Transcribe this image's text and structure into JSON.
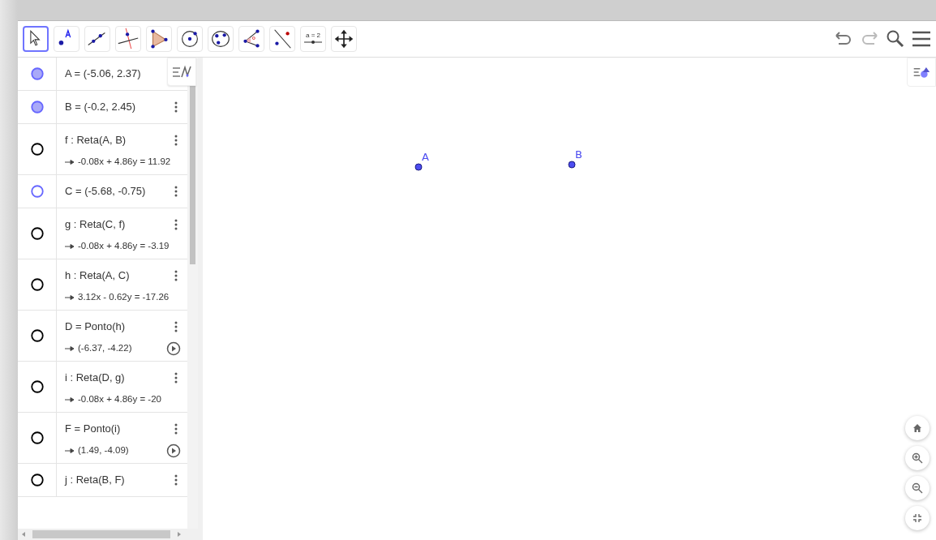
{
  "toolbar": {
    "tools": [
      {
        "kind": "move",
        "selected": true
      },
      {
        "kind": "point",
        "selected": false
      },
      {
        "kind": "line",
        "selected": false
      },
      {
        "kind": "perpendicular",
        "selected": false
      },
      {
        "kind": "polygon",
        "selected": false
      },
      {
        "kind": "circle",
        "selected": false
      },
      {
        "kind": "conic",
        "selected": false
      },
      {
        "kind": "angle",
        "selected": false
      },
      {
        "kind": "reflect",
        "selected": false
      },
      {
        "kind": "slider",
        "selected": false,
        "label": "a = 2"
      },
      {
        "kind": "pan",
        "selected": false
      }
    ]
  },
  "algebra": {
    "items": [
      {
        "definition": "A = (-5.06, 2.37)",
        "visible": true,
        "color": "#6666ff",
        "menu": false,
        "animation": false
      },
      {
        "definition": "B = (-0.2, 2.45)",
        "visible": true,
        "color": "#6666ff",
        "menu": true,
        "animation": false
      },
      {
        "definition": "f : Reta(A, B)",
        "value": "-0.08x + 4.86y = 11.92",
        "visible": false,
        "color": "#000000",
        "menu": true,
        "animation": false
      },
      {
        "definition": "C = (-5.68, -0.75)",
        "visible": false,
        "color": "#6666ff",
        "menu": true,
        "animation": false
      },
      {
        "definition": "g : Reta(C, f)",
        "value": "-0.08x + 4.86y = -3.19",
        "visible": false,
        "color": "#000000",
        "menu": true,
        "animation": false
      },
      {
        "definition": "h : Reta(A, C)",
        "value": "3.12x - 0.62y = -17.26",
        "visible": false,
        "color": "#000000",
        "menu": true,
        "animation": false
      },
      {
        "definition": "D = Ponto(h)",
        "value": "(-6.37, -4.22)",
        "visible": false,
        "color": "#000000",
        "menu": true,
        "animation": true
      },
      {
        "definition": "i : Reta(D, g)",
        "value": "-0.08x + 4.86y = -20",
        "visible": false,
        "color": "#000000",
        "menu": true,
        "animation": false
      },
      {
        "definition": "F = Ponto(i)",
        "value": "(1.49, -4.09)",
        "visible": false,
        "color": "#000000",
        "menu": true,
        "animation": true
      },
      {
        "definition": "j : Reta(B, F)",
        "visible": false,
        "color": "#000000",
        "menu": true,
        "animation": false
      }
    ]
  },
  "graphics": {
    "points": [
      {
        "label": "A"
      },
      {
        "label": "B"
      }
    ]
  }
}
